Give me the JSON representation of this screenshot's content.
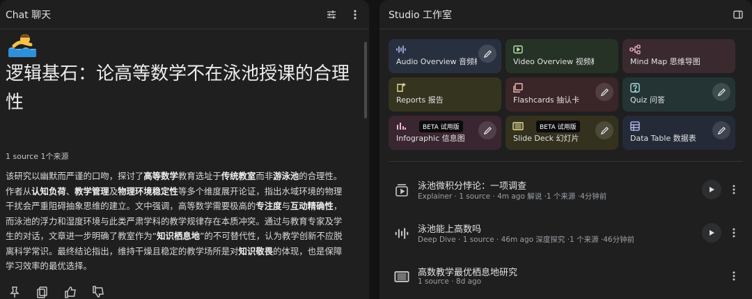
{
  "chat": {
    "title": "Chat  聊天",
    "note_title": "逻辑基石：论高等数学不在泳池授课的合理性",
    "source_meta": "1 source   1个来源",
    "summary_parts": [
      {
        "t": "该研究以幽默而严谨的口吻，探讨了",
        "b": false
      },
      {
        "t": "高等数学",
        "b": true
      },
      {
        "t": "教育选址于",
        "b": false
      },
      {
        "t": "传统教室",
        "b": true
      },
      {
        "t": "而非",
        "b": false
      },
      {
        "t": "游泳池",
        "b": true
      },
      {
        "t": "的合理性。作者从",
        "b": false
      },
      {
        "t": "认知负荷",
        "b": true
      },
      {
        "t": "、",
        "b": false
      },
      {
        "t": "教学管理",
        "b": true
      },
      {
        "t": "及",
        "b": false
      },
      {
        "t": "物理环境稳定性",
        "b": true
      },
      {
        "t": "等多个维度展开论证，指出水域环境的物理干扰会严重阻碍抽象思维的建立。文中强调，高等数学需要极高的",
        "b": false
      },
      {
        "t": "专注度",
        "b": true
      },
      {
        "t": "与",
        "b": false
      },
      {
        "t": "互动精确性",
        "b": true
      },
      {
        "t": "，而泳池的浮力和湿度环境与此类严肃学科的教学规律存在本质冲突。通过与教育专家及学生的对话，文章进一步明确了教室作为“",
        "b": false
      },
      {
        "t": "知识栖息地",
        "b": true
      },
      {
        "t": "”的不可替代性，认为教学创新不应脱离科学常识。最终结论指出，维持干燥且稳定的教学场所是对",
        "b": false
      },
      {
        "t": "知识敬畏",
        "b": true
      },
      {
        "t": "的体现，也是保障学习效率的最优选择。",
        "b": false
      }
    ]
  },
  "studio": {
    "title": "Studio  工作室",
    "tiles": [
      {
        "label": "Audio Overview  音频概述",
        "icon": "audio-waveform-icon",
        "bg": "#283040",
        "accent": "#c2c9ff",
        "edit": true,
        "beta": ""
      },
      {
        "label": "Video Overview  视频概述",
        "icon": "video-icon",
        "bg": "#263226",
        "accent": "#b5e3a8",
        "edit": false,
        "beta": ""
      },
      {
        "label": "Mind Map  思维导图",
        "icon": "mind-map-icon",
        "bg": "#3a2a30",
        "accent": "#f2b8d0",
        "edit": false,
        "beta": ""
      },
      {
        "label": "Reports  报告",
        "icon": "report-icon",
        "bg": "#35341f",
        "accent": "#e8dd9a",
        "edit": false,
        "beta": ""
      },
      {
        "label": "Flashcards  抽认卡",
        "icon": "flashcards-icon",
        "bg": "#3a2528",
        "accent": "#f2b8b8",
        "edit": true,
        "beta": ""
      },
      {
        "label": "Quiz  问答",
        "icon": "quiz-icon",
        "bg": "#243434",
        "accent": "#a8dede",
        "edit": true,
        "beta": ""
      },
      {
        "label": "Infographic  信息图",
        "icon": "infographic-icon",
        "bg": "#3a2630",
        "accent": "#f2b8cf",
        "edit": true,
        "beta": "BETA  试用版"
      },
      {
        "label": "Slide Deck  幻灯片",
        "icon": "slide-deck-icon",
        "bg": "#34311e",
        "accent": "#e8dd9a",
        "edit": true,
        "beta": "BETA  试用版"
      },
      {
        "label": "Data Table  数据表",
        "icon": "data-table-icon",
        "bg": "#252a38",
        "accent": "#c2c9ff",
        "edit": true,
        "beta": ""
      }
    ],
    "items": [
      {
        "title": "泳池微积分悖论：一项调查",
        "sub": "Explainer · 1 source · 4m ago  解说 ·1 个来源 ·4分钟前",
        "icon": "explainer-video-icon",
        "play": true
      },
      {
        "title": "泳池能上高数吗",
        "sub": "Deep Dive · 1 source · 46m ago  深度探究 ·1 个来源 ·46分钟前",
        "icon": "audio-waveform-icon",
        "play": true
      },
      {
        "title": "高数教学最优栖息地研究",
        "sub": "1 source · 8d ago",
        "icon": "slide-deck-icon",
        "play": false
      }
    ]
  }
}
